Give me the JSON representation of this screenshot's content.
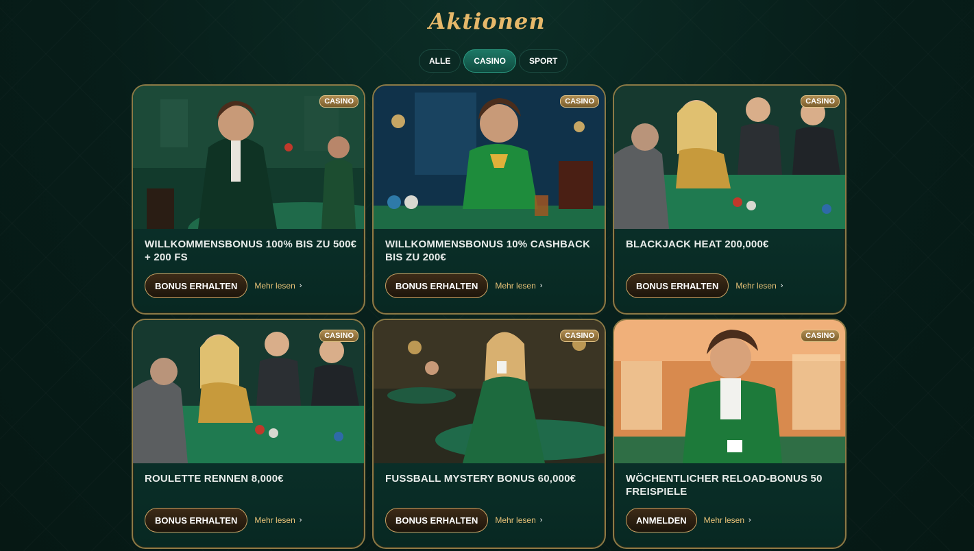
{
  "page": {
    "title": "Aktionen"
  },
  "tabs": [
    {
      "label": "ALLE",
      "active": false
    },
    {
      "label": "CASINO",
      "active": true
    },
    {
      "label": "SPORT",
      "active": false
    }
  ],
  "colors": {
    "accent_gold": "#e6b86a",
    "tab_active": "#1d7866",
    "background": "#07211c",
    "card_border": "#8c7a46"
  },
  "cards": [
    {
      "badge": "CASINO",
      "title": "WILLKOMMENSBONUS 100% BIS ZU 500€ + 200 FS",
      "button": "BONUS ERHALTEN",
      "more": "Mehr lesen",
      "chevron": "›"
    },
    {
      "badge": "CASINO",
      "title": "WILLKOMMENSBONUS 10% CASHBACK BIS ZU 200€",
      "button": "BONUS ERHALTEN",
      "more": "Mehr lesen",
      "chevron": "›"
    },
    {
      "badge": "CASINO",
      "title": "BLACKJACK HEAT 200,000€",
      "button": "BONUS ERHALTEN",
      "more": "Mehr lesen",
      "chevron": "›"
    },
    {
      "badge": "CASINO",
      "title": "ROULETTE RENNEN 8,000€",
      "button": "BONUS ERHALTEN",
      "more": "Mehr lesen",
      "chevron": "›"
    },
    {
      "badge": "CASINO",
      "title": "FUSSBALL MYSTERY BONUS 60,000€",
      "button": "BONUS ERHALTEN",
      "more": "Mehr lesen",
      "chevron": "›"
    },
    {
      "badge": "CASINO",
      "title": "WÖCHENTLICHER RELOAD-BONUS 50 FREISPIELE",
      "button": "ANMELDEN",
      "more": "Mehr lesen",
      "chevron": "›"
    }
  ]
}
